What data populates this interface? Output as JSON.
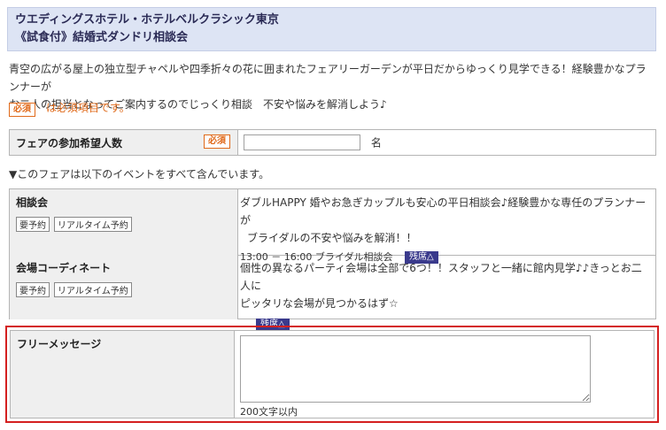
{
  "header": {
    "line1": "ウエディングスホテル・ホテルベルクラシック東京",
    "line2": "《試食付》結婚式ダンドリ相談会"
  },
  "intro": {
    "line1": "青空の広がる屋上の独立型チャペルや四季折々の花に囲まれたフェアリーガーデンが平日だからゆっくり見学できる！経験豊かなプランナーが",
    "line2": "お二人の担当となってご案内するのでじっくり相談　不安や悩みを解消しよう♪"
  },
  "required_badge": "必須",
  "required_note": "は必須項目です。",
  "participants": {
    "label": "フェアの参加希望人数",
    "badge": "必須",
    "value": "",
    "unit": "名"
  },
  "events_note": "▼このフェアは以下のイベントをすべて含んでいます。",
  "events": [
    {
      "name": "相談会",
      "tags": [
        "要予約",
        "リアルタイム予約"
      ],
      "desc_line1": "ダブルHAPPY 婚やお急ぎカップルも安心の平日相談会♪経験豊かな専任のプランナーが",
      "desc_line2": "ブライダルの不安や悩みを解消！！",
      "time": "13:00 － 16:00",
      "time_label": "ブライダル相談会",
      "seat": "残席△"
    },
    {
      "name": "会場コーディネート",
      "tags": [
        "要予約",
        "リアルタイム予約"
      ],
      "desc_line1": "個性の異なるパーティ会場は全部で6つ！！スタッフと一緒に館内見学♪♪きっとお二人に",
      "desc_line2": "ピッタリな会場が見つかるはず☆",
      "seat": "残席△"
    }
  ],
  "free_message": {
    "label": "フリーメッセージ",
    "value": "",
    "limit": "200文字以内"
  },
  "colors": {
    "header_bg": "#dde4f4",
    "required": "#e06a1a",
    "seat_badge": "#3a3a8c",
    "highlight_border": "#d42020"
  }
}
